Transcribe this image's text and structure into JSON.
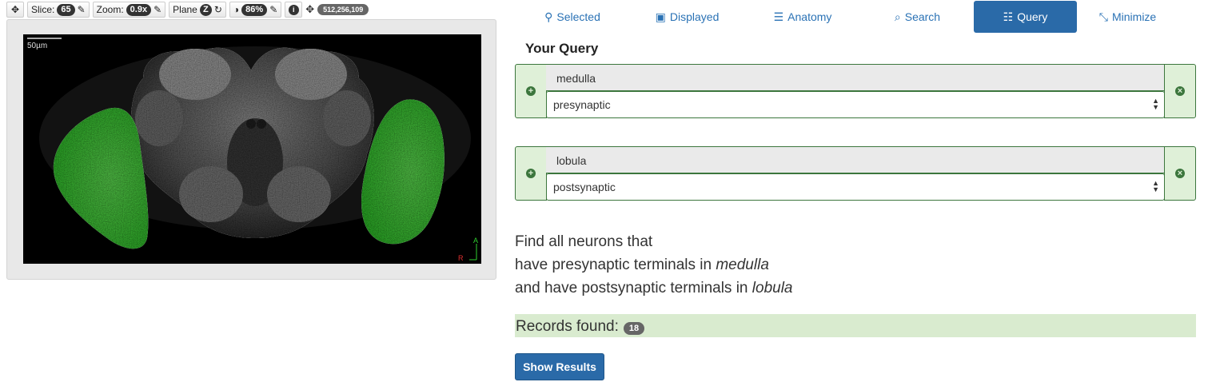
{
  "toolbar": {
    "slice_label": "Slice:",
    "slice_value": "65",
    "zoom_label": "Zoom:",
    "zoom_value": "0.9x",
    "plane_label": "Plane",
    "plane_value": "Z",
    "contrast_value": "86%",
    "info_glyph": "i",
    "coordinates": "512,256,109"
  },
  "viewer": {
    "scale_label": "50µm",
    "orient_a": "A",
    "orient_r": "R",
    "highlight_color": "#3fcf3a"
  },
  "nav": {
    "tabs": [
      {
        "label": "Selected",
        "icon": "map-marker-icon"
      },
      {
        "label": "Displayed",
        "icon": "picture-icon"
      },
      {
        "label": "Anatomy",
        "icon": "list-icon"
      },
      {
        "label": "Search",
        "icon": "search-icon"
      },
      {
        "label": "Query",
        "icon": "tasks-icon",
        "active": true
      },
      {
        "label": "Minimize",
        "icon": "compress-icon"
      }
    ]
  },
  "query": {
    "title": "Your Query",
    "items": [
      {
        "term": "medulla",
        "relation": "presynaptic"
      },
      {
        "term": "lobula",
        "relation": "postsynaptic"
      }
    ],
    "description": {
      "line1": "Find all neurons that",
      "line2_prefix": "have presynaptic terminals in ",
      "line2_term": "medulla",
      "line3_prefix": "and have postsynaptic terminals in ",
      "line3_term": "lobula"
    },
    "records_label": "Records found:",
    "records_count": "18",
    "show_results_label": "Show Results"
  },
  "colors": {
    "primary": "#2a6aa8",
    "success_bg": "#dff0d8",
    "success_border": "#3c763d",
    "records_bg": "#d9ebcf"
  }
}
